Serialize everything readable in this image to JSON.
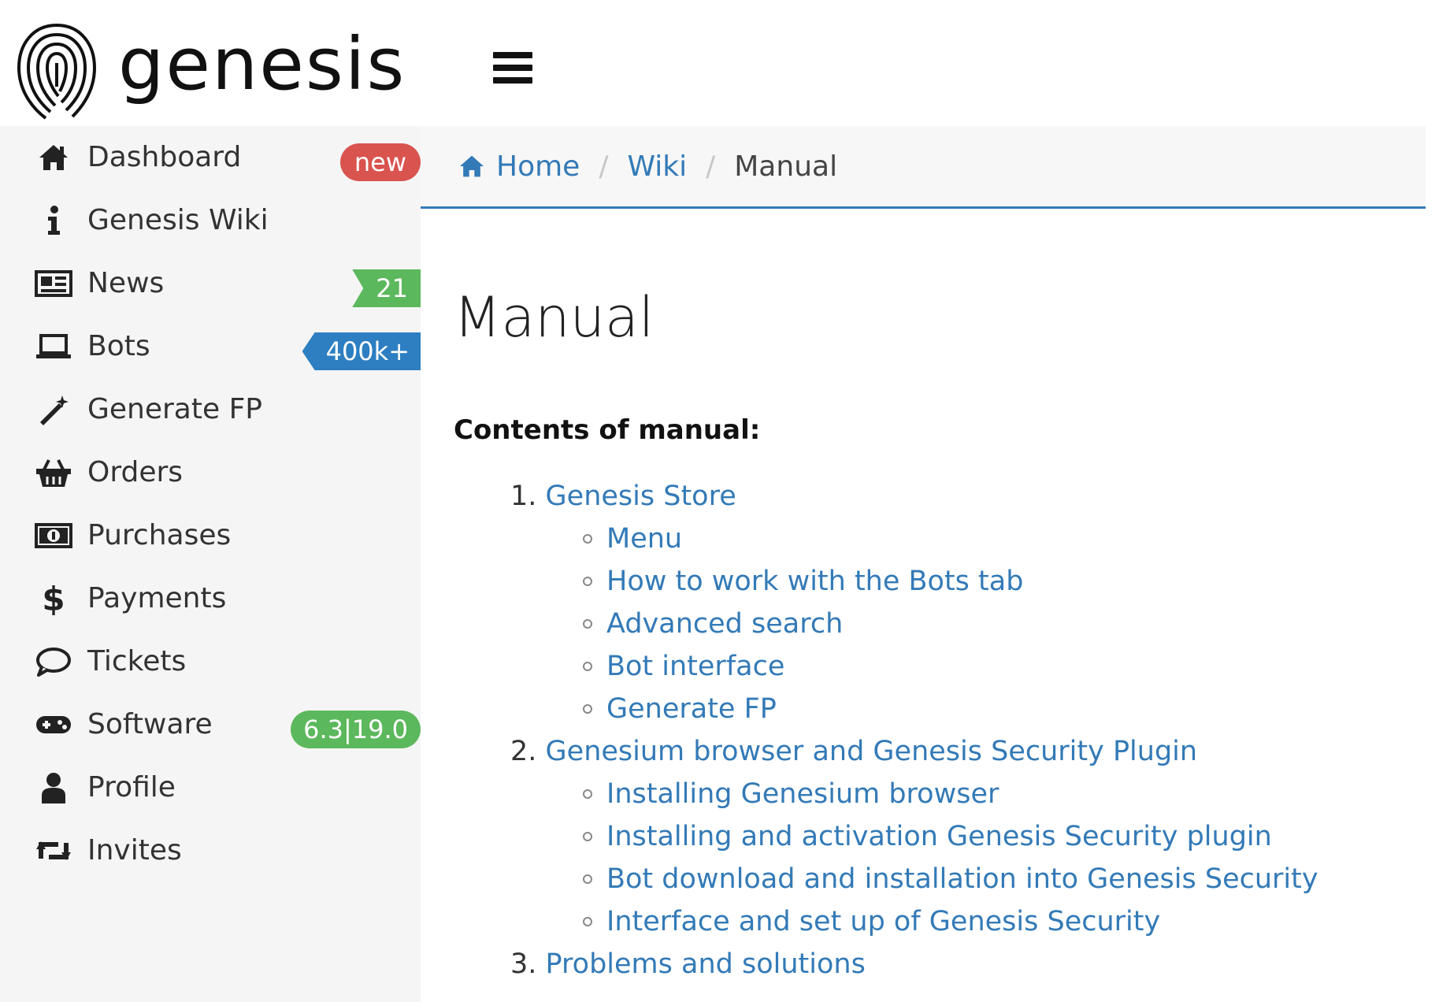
{
  "header": {
    "logo_text": "genesis",
    "menu_icon": "hamburger-menu-icon"
  },
  "sidebar": {
    "items": [
      {
        "label": "Dashboard",
        "icon": "home-icon",
        "badge": "new",
        "badge_color": "#d9534f"
      },
      {
        "label": "Genesis Wiki",
        "icon": "info-icon"
      },
      {
        "label": "News",
        "icon": "newspaper-icon",
        "badge": "21",
        "badge_color": "#5cb85c"
      },
      {
        "label": "Bots",
        "icon": "laptop-icon",
        "badge": "400k+",
        "badge_color": "#2d7fc1"
      },
      {
        "label": "Generate FP",
        "icon": "magic-wand-icon"
      },
      {
        "label": "Orders",
        "icon": "basket-icon"
      },
      {
        "label": "Purchases",
        "icon": "money-icon"
      },
      {
        "label": "Payments",
        "icon": "dollar-icon"
      },
      {
        "label": "Tickets",
        "icon": "comment-icon"
      },
      {
        "label": "Software",
        "icon": "gamepad-icon",
        "badge": "6.3|19.0",
        "badge_color": "#5cb85c"
      },
      {
        "label": "Profile",
        "icon": "user-icon"
      },
      {
        "label": "Invites",
        "icon": "retweet-icon"
      }
    ]
  },
  "breadcrumb": {
    "items": [
      "Home",
      "Wiki",
      "Manual"
    ],
    "separator": "/"
  },
  "main": {
    "title": "Manual",
    "contents_heading": "Contents of manual:",
    "toc": [
      {
        "number": "1.",
        "label": "Genesis Store",
        "children": [
          "Menu",
          "How to work with the Bots tab",
          "Advanced search",
          "Bot interface",
          "Generate FP"
        ]
      },
      {
        "number": "2.",
        "label": "Genesium browser and Genesis Security Plugin",
        "children": [
          "Installing Genesium browser",
          "Installing and activation Genesis Security plugin",
          "Bot download and installation into Genesis Security",
          "Interface and set up of Genesis Security"
        ]
      },
      {
        "number": "3.",
        "label": "Problems and solutions",
        "children": []
      }
    ]
  },
  "colors": {
    "link": "#337ab7",
    "sidebar_bg": "#f5f5f5",
    "badge_red": "#d9534f",
    "badge_green": "#5cb85c",
    "badge_blue": "#2d7fc1"
  }
}
